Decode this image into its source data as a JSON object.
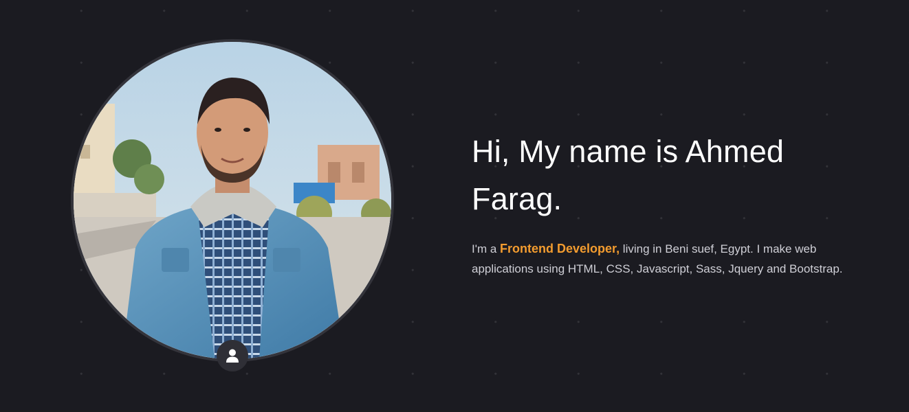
{
  "hero": {
    "portrait_alt": "Ahmed Farag",
    "badge_icon": "user-icon",
    "heading": "Hi, My name is Ahmed Farag.",
    "bio_prefix": "I'm a ",
    "bio_role": "Frontend Developer,",
    "bio_suffix": " living in Beni suef, Egypt. I make web applications using HTML, CSS, Javascript, Sass, Jquery and Bootstrap."
  },
  "colors": {
    "background": "#1b1b21",
    "accent": "#f39c2f",
    "heading": "#ffffff",
    "body_text": "#cfcfd6",
    "ring": "#34343b"
  }
}
